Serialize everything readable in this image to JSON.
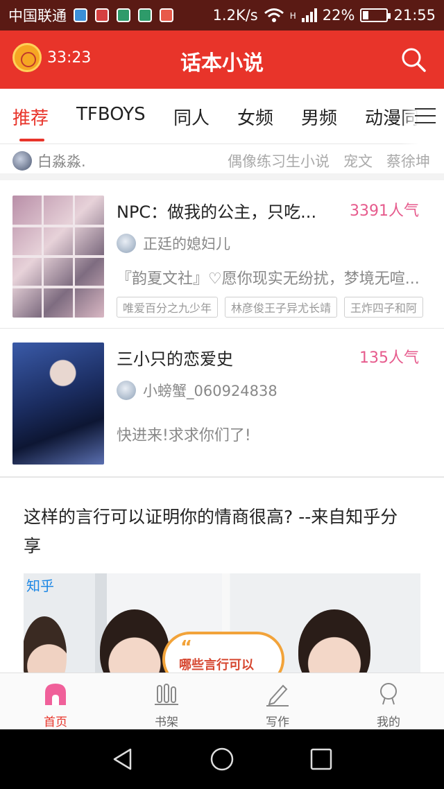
{
  "status_bar": {
    "carrier": "中国联通",
    "speed": "1.2K/s",
    "network": "H",
    "battery": "22%",
    "battery_level": 0.22,
    "time": "21:55"
  },
  "header": {
    "timer": "33:23",
    "title": "话本小说"
  },
  "tabs": [
    {
      "label": "推荐",
      "active": true
    },
    {
      "label": "TFBOYS",
      "active": false
    },
    {
      "label": "同人",
      "active": false
    },
    {
      "label": "女频",
      "active": false
    },
    {
      "label": "男频",
      "active": false
    },
    {
      "label": "动漫同",
      "active": false
    }
  ],
  "tag_strip": {
    "user": "白淼淼.",
    "hot_tags": [
      "偶像练习生小说",
      "宠文",
      "蔡徐坤"
    ]
  },
  "stories": [
    {
      "title": "NPC：做我的公主，只吃...",
      "popularity": "3391人气",
      "author": "正廷的媳妇儿",
      "description": "『韵夏文社』♡愿你现实无纷扰，梦境无喧...",
      "tags": [
        "唯爱百分之九少年",
        "林彦俊王子异尤长靖",
        "王炸四子和阿"
      ]
    },
    {
      "title": "三小只的恋爱史",
      "popularity": "135人气",
      "author": "小螃蟹_060924838",
      "description": "快进来!求求你们了!",
      "tags": []
    }
  ],
  "article": {
    "title": "这样的言行可以证明你的情商很高? --来自知乎分享",
    "image_source": "知乎",
    "image_caption_quote": "“",
    "image_caption": "哪些言行可以"
  },
  "bottom_nav": [
    {
      "label": "首页",
      "icon": "home-icon",
      "active": true
    },
    {
      "label": "书架",
      "icon": "bookshelf-icon",
      "active": false
    },
    {
      "label": "写作",
      "icon": "pen-icon",
      "active": false
    },
    {
      "label": "我的",
      "icon": "profile-icon",
      "active": false
    }
  ],
  "colors": {
    "brand_red": "#e8342a",
    "popularity_pink": "#e65a8c"
  }
}
